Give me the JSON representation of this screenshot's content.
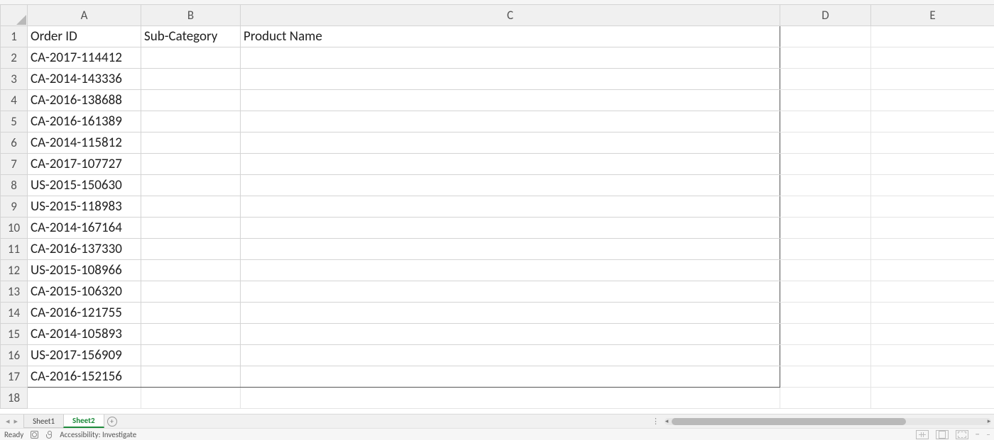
{
  "columnHeaders": [
    "A",
    "B",
    "C",
    "D",
    "E"
  ],
  "rowNumbers": [
    1,
    2,
    3,
    4,
    5,
    6,
    7,
    8,
    9,
    10,
    11,
    12,
    13,
    14,
    15,
    16,
    17,
    18
  ],
  "headers": {
    "A": "Order ID",
    "B": "Sub-Category",
    "C": "Product Name"
  },
  "dataRows": [
    {
      "A": "CA-2017-114412",
      "B": "",
      "C": ""
    },
    {
      "A": "CA-2014-143336",
      "B": "",
      "C": ""
    },
    {
      "A": "CA-2016-138688",
      "B": "",
      "C": ""
    },
    {
      "A": "CA-2016-161389",
      "B": "",
      "C": ""
    },
    {
      "A": "CA-2014-115812",
      "B": "",
      "C": ""
    },
    {
      "A": "CA-2017-107727",
      "B": "",
      "C": ""
    },
    {
      "A": "US-2015-150630",
      "B": "",
      "C": ""
    },
    {
      "A": "US-2015-118983",
      "B": "",
      "C": ""
    },
    {
      "A": "CA-2014-167164",
      "B": "",
      "C": ""
    },
    {
      "A": "CA-2016-137330",
      "B": "",
      "C": ""
    },
    {
      "A": "US-2015-108966",
      "B": "",
      "C": ""
    },
    {
      "A": "CA-2015-106320",
      "B": "",
      "C": ""
    },
    {
      "A": "CA-2016-121755",
      "B": "",
      "C": ""
    },
    {
      "A": "CA-2014-105893",
      "B": "",
      "C": ""
    },
    {
      "A": "US-2017-156909",
      "B": "",
      "C": ""
    },
    {
      "A": "CA-2016-152156",
      "B": "",
      "C": ""
    }
  ],
  "sheetTabs": [
    {
      "label": "Sheet1",
      "active": false
    },
    {
      "label": "Sheet2",
      "active": true
    }
  ],
  "status": {
    "ready": "Ready",
    "accessibility": "Accessibility: Investigate"
  }
}
